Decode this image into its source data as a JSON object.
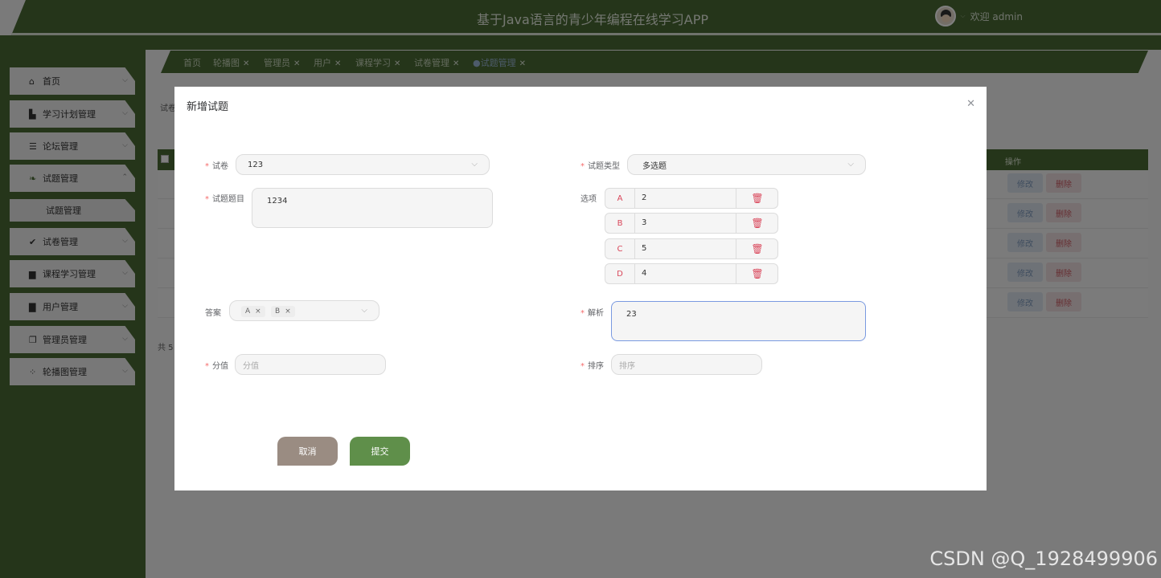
{
  "header": {
    "title": "基于Java语言的青少年编程在线学习APP",
    "welcome": "欢迎 admin"
  },
  "sidebar": {
    "items": [
      {
        "label": "首页",
        "icon": "home-icon"
      },
      {
        "label": "学习计划管理",
        "icon": "bar-chart-icon"
      },
      {
        "label": "论坛管理",
        "icon": "list-icon"
      },
      {
        "label": "试题管理",
        "icon": "leaf-icon"
      },
      {
        "label": "试卷管理",
        "icon": "check-circle-icon"
      },
      {
        "label": "课程学习管理",
        "icon": "briefcase-icon"
      },
      {
        "label": "用户管理",
        "icon": "document-icon"
      },
      {
        "label": "管理员管理",
        "icon": "copy-icon"
      },
      {
        "label": "轮播图管理",
        "icon": "grid-icon"
      }
    ],
    "sub_item": "试题管理"
  },
  "tabs": [
    "首页",
    "轮播图",
    "管理员",
    "用户",
    "课程学习",
    "试卷管理",
    "●试题管理"
  ],
  "background": {
    "label_left": "试卷",
    "op_header": "操作",
    "edit_label": "修改",
    "delete_label": "删除",
    "total_label": "共 5"
  },
  "dialog": {
    "title": "新增试题",
    "paper_label": "试卷",
    "paper_value": "123",
    "type_label": "试题类型",
    "type_value": "多选题",
    "question_label": "试题题目",
    "question_value": "1234",
    "options_label": "选项",
    "options": [
      {
        "letter": "A",
        "value": "2"
      },
      {
        "letter": "B",
        "value": "3"
      },
      {
        "letter": "C",
        "value": "5"
      },
      {
        "letter": "D",
        "value": "4"
      }
    ],
    "answer_label": "答案",
    "answer_tags": [
      "A",
      "B"
    ],
    "analysis_label": "解析",
    "analysis_value": "23",
    "score_label": "分值",
    "score_placeholder": "分值",
    "order_label": "排序",
    "order_placeholder": "排序",
    "cancel": "取消",
    "submit": "提交"
  },
  "watermark": "CSDN @Q_1928499906",
  "colors": {
    "primary_green": "#4a6b34",
    "submit_green": "#5f8f4a",
    "cancel_brown": "#9a8c82",
    "danger": "#d9465a"
  }
}
